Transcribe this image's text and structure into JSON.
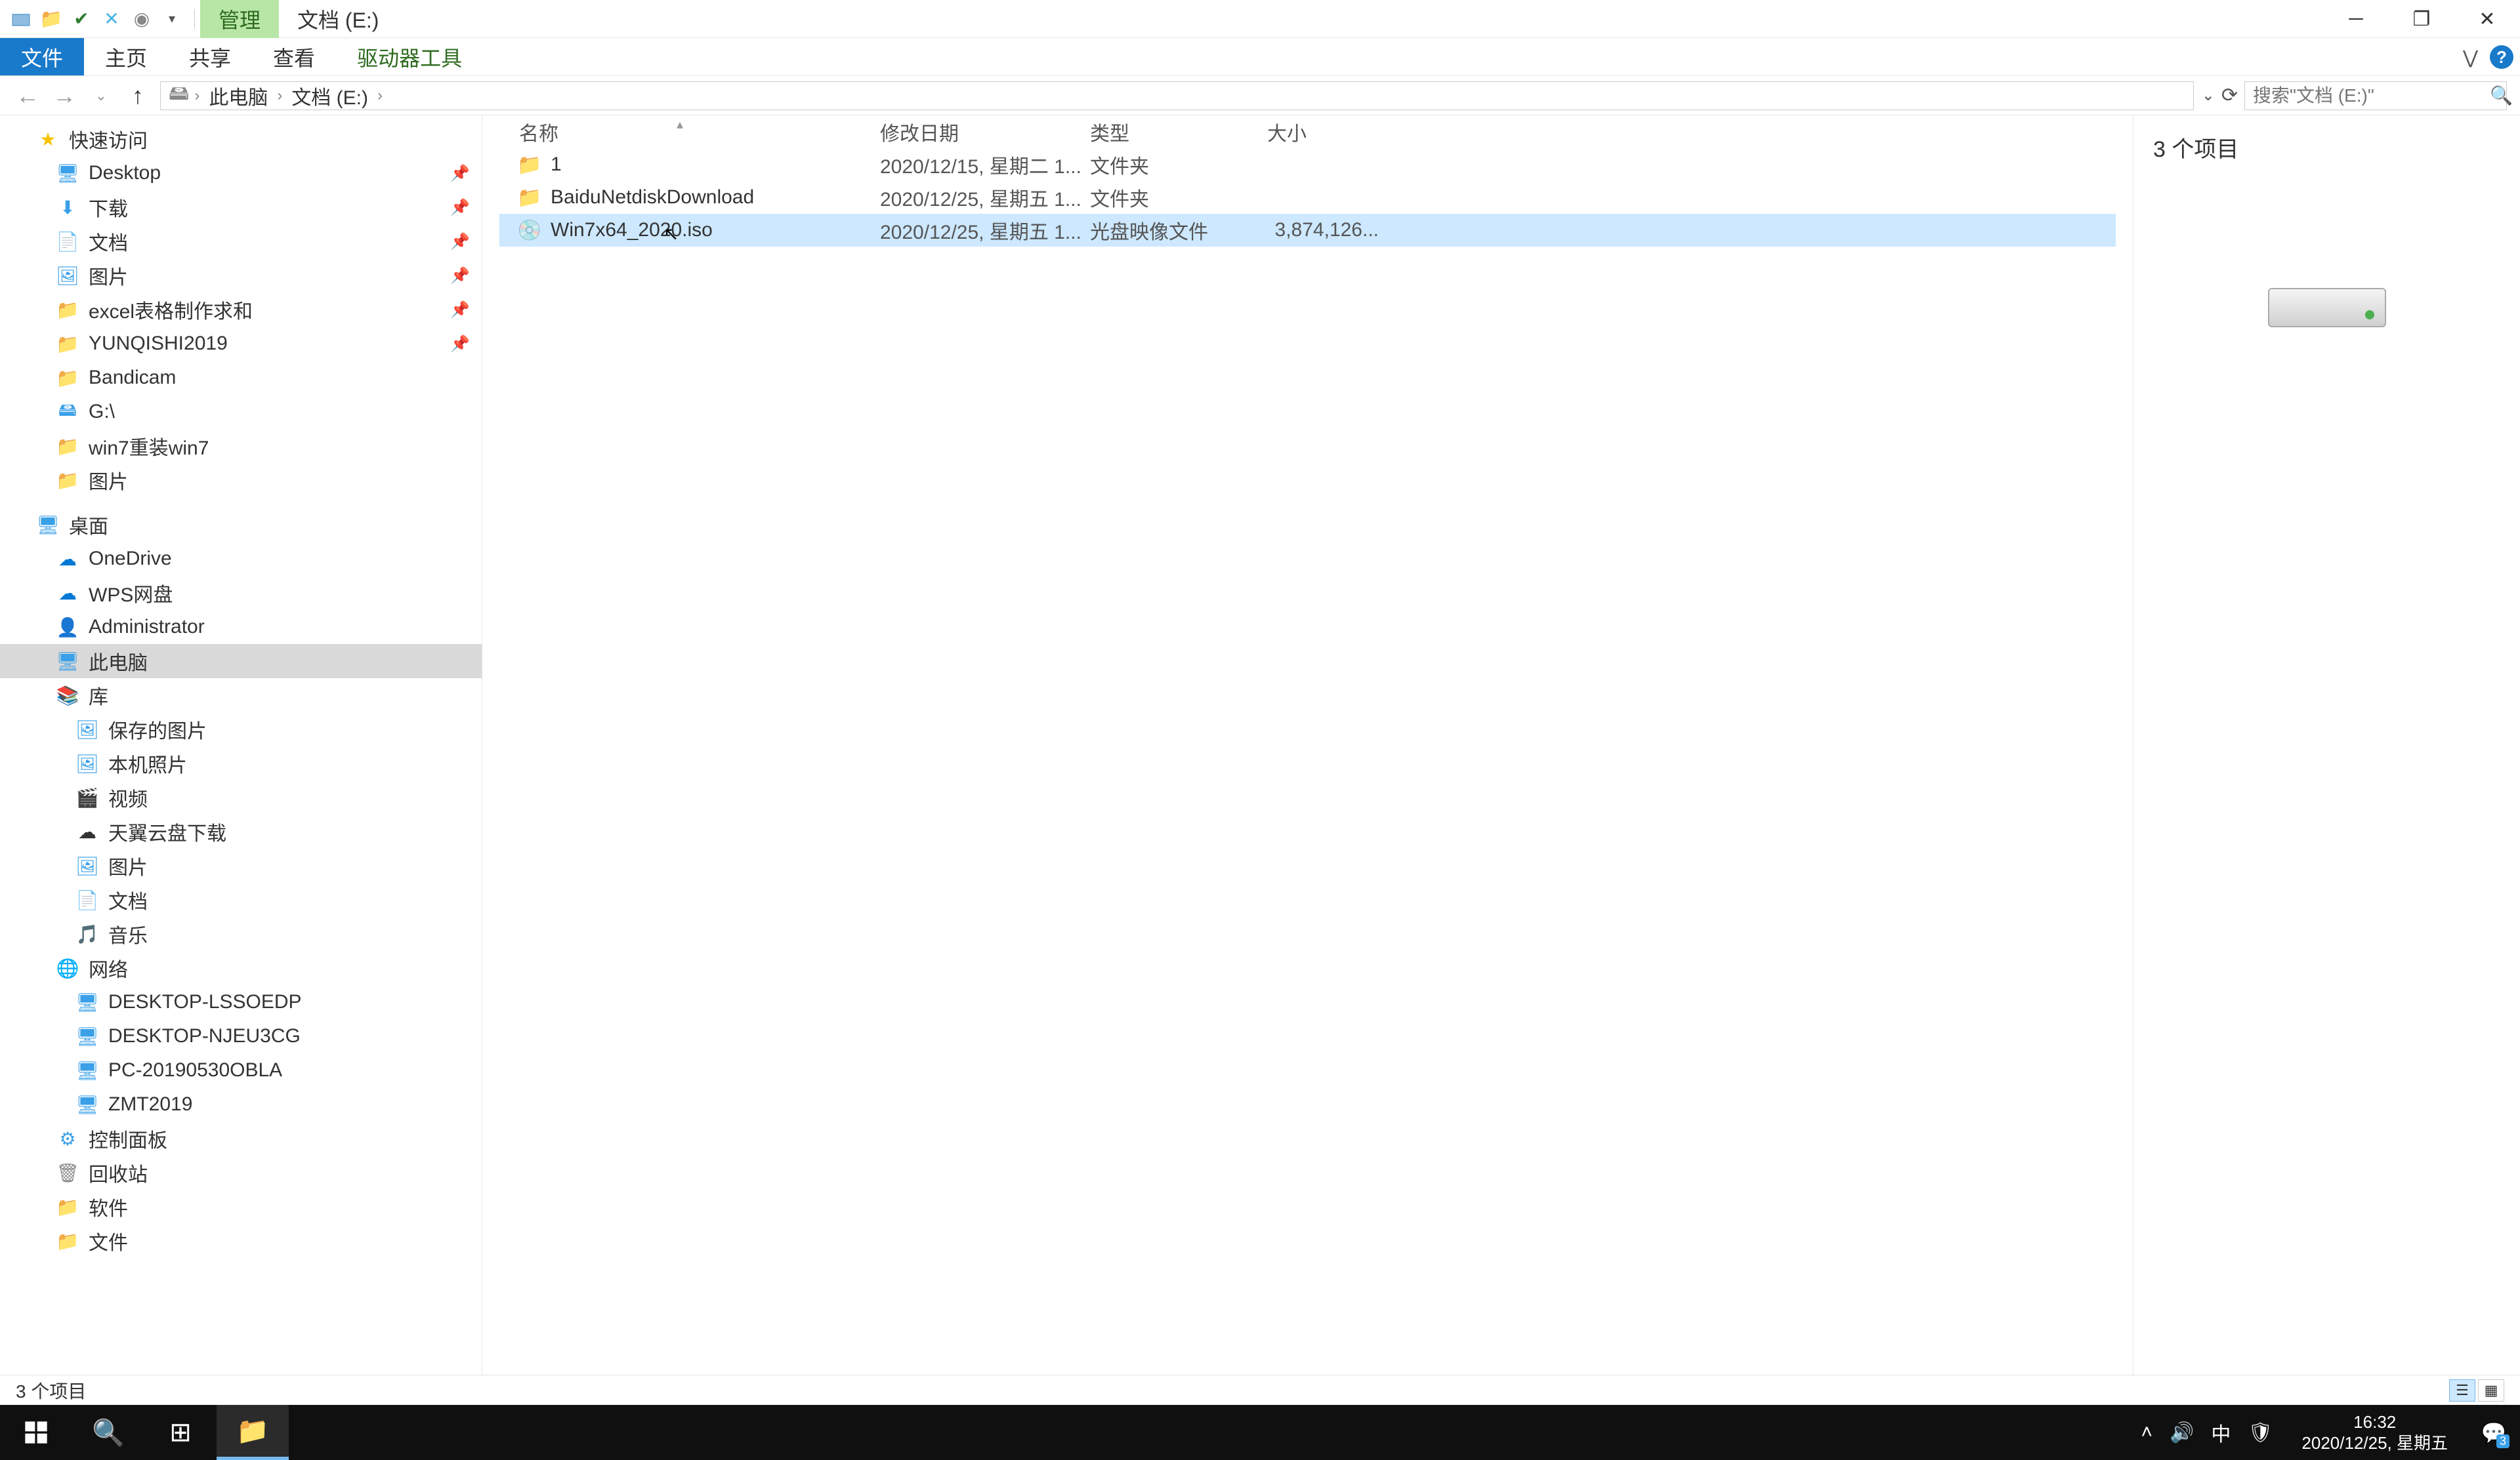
{
  "titlebar": {
    "manage_tab": "管理",
    "location_tab": "文档 (E:)"
  },
  "ribbon": {
    "file": "文件",
    "home": "主页",
    "share": "共享",
    "view": "查看",
    "drive_tools": "驱动器工具"
  },
  "address": {
    "crumbs": [
      "此电脑",
      "文档 (E:)"
    ],
    "search_placeholder": "搜索\"文档 (E:)\""
  },
  "sidebar": {
    "quick_access": "快速访问",
    "pinned": [
      {
        "icon": "desktop",
        "label": "Desktop"
      },
      {
        "icon": "download",
        "label": "下载"
      },
      {
        "icon": "document",
        "label": "文档"
      },
      {
        "icon": "picture",
        "label": "图片"
      },
      {
        "icon": "folder",
        "label": "excel表格制作求和"
      },
      {
        "icon": "folder",
        "label": "YUNQISHI2019"
      }
    ],
    "recent": [
      {
        "icon": "folder",
        "label": "Bandicam"
      },
      {
        "icon": "gdrive",
        "label": "G:\\"
      },
      {
        "icon": "folder",
        "label": "win7重装win7"
      },
      {
        "icon": "folder",
        "label": "图片"
      }
    ],
    "desktop_root": "桌面",
    "desktop_items": [
      {
        "icon": "onedrive",
        "label": "OneDrive"
      },
      {
        "icon": "wps",
        "label": "WPS网盘"
      },
      {
        "icon": "user",
        "label": "Administrator"
      },
      {
        "icon": "pc",
        "label": "此电脑",
        "selected": true
      },
      {
        "icon": "library",
        "label": "库"
      }
    ],
    "libraries": [
      {
        "label": "保存的图片"
      },
      {
        "label": "本机照片"
      },
      {
        "label": "视频"
      },
      {
        "label": "天翼云盘下载"
      },
      {
        "label": "图片"
      },
      {
        "label": "文档"
      },
      {
        "label": "音乐"
      }
    ],
    "network": "网络",
    "network_items": [
      {
        "label": "DESKTOP-LSSOEDP"
      },
      {
        "label": "DESKTOP-NJEU3CG"
      },
      {
        "label": "PC-20190530OBLA"
      },
      {
        "label": "ZMT2019"
      }
    ],
    "control_panel": "控制面板",
    "recycle": "回收站",
    "software": "软件",
    "files_folder": "文件"
  },
  "columns": {
    "name": "名称",
    "date": "修改日期",
    "type": "类型",
    "size": "大小"
  },
  "files": [
    {
      "icon": "folder",
      "name": "1",
      "date": "2020/12/15, 星期二 1...",
      "type": "文件夹",
      "size": ""
    },
    {
      "icon": "folder",
      "name": "BaiduNetdiskDownload",
      "date": "2020/12/25, 星期五 1...",
      "type": "文件夹",
      "size": ""
    },
    {
      "icon": "iso",
      "name": "Win7x64_2020.iso",
      "date": "2020/12/25, 星期五 1...",
      "type": "光盘映像文件",
      "size": "3,874,126...",
      "selected": true
    }
  ],
  "preview": {
    "title": "3 个项目"
  },
  "statusbar": {
    "text": "3 个项目"
  },
  "taskbar": {
    "time": "16:32",
    "date": "2020/12/25, 星期五",
    "ime": "中",
    "notif_count": "3"
  }
}
